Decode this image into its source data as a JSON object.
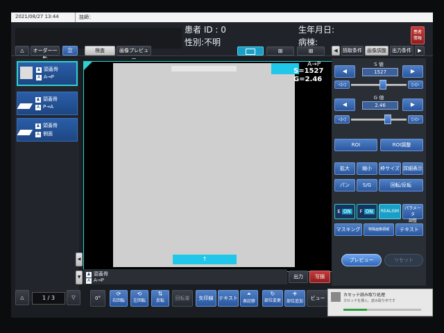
{
  "header": {
    "datetime": "2021/08/27 13:44",
    "technician_label": "技師：",
    "patient_id": "患者 ID : 0",
    "sex": "性別:不明",
    "birthdate": "生年月日:",
    "ward": "病棟:",
    "patient_info_button": "患者\n情報"
  },
  "left_panel": {
    "tabs": [
      "オーダー一覧",
      "立"
    ],
    "series": [
      {
        "body_part": "頭蓋骨",
        "direction": "A→P"
      },
      {
        "body_part": "頭蓋骨",
        "direction": "P→A"
      },
      {
        "body_part": "頭蓋骨",
        "direction": "側面"
      }
    ],
    "page_indicator": "1 / 3"
  },
  "center": {
    "tabs": [
      "検査",
      "画像プレビュー"
    ],
    "overlay": {
      "direction": "A→P",
      "s_value": "S=1527",
      "g_value": "G=2.46"
    },
    "bottom_marker": "↑",
    "bottom_series_name": "頭蓋骨",
    "bottom_series_dir": "A→P",
    "output_button": "出力",
    "reshoot_button": "写損"
  },
  "right_panel": {
    "tabs": [
      "読取条件",
      "画像調整",
      "出力条件",
      "▶"
    ],
    "s_label": "S 値",
    "s_value": "1527",
    "g_label": "G 値",
    "g_value": "2.46",
    "s_slider_level": 0.58,
    "g_slider_level": 0.66,
    "roi": "ROI",
    "roi_adjust": "ROI調整",
    "zoom_in": "拡大",
    "zoom_out": "縮小",
    "frame_size": "枠サイズ",
    "details": "詳細表示",
    "pan": "パン",
    "sg": "S/G",
    "rotate": "回転/反転",
    "e_on": "E",
    "f_on": "F",
    "on_label": "ON",
    "realism": "REALISM",
    "param_adjust": "パラメータ\n調整",
    "masking": "マスキング",
    "special": "特殊画像領域",
    "text": "テキスト",
    "preview": "プレビュー",
    "reset": "リセット"
  },
  "toolbar": {
    "buttons": [
      "0°",
      "右回転",
      "左回転",
      "反転",
      "回転量",
      "矢印線",
      "テキスト",
      "表記移",
      "部位変更",
      "部位追加",
      "ビュー"
    ]
  },
  "notification": {
    "title": "カセッテ読み取り処理",
    "subtitle": "カセッテを挿入、読み取り中です",
    "progress": 0.3
  }
}
